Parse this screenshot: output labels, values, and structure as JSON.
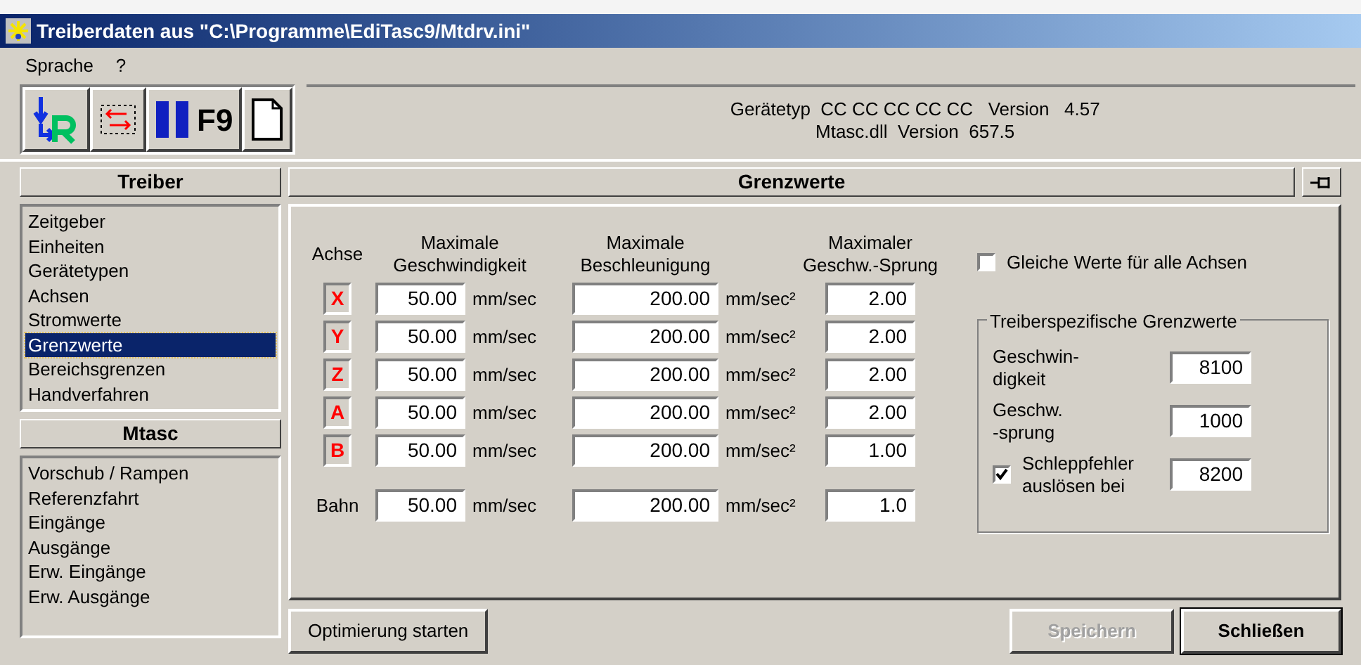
{
  "window": {
    "title": "Treiberdaten aus \"C:\\Programme\\EdiTasc9/Mtdrv.ini\""
  },
  "menu": [
    {
      "label": "Sprache"
    },
    {
      "label": "?"
    }
  ],
  "toolbar": [
    {
      "kind": "import"
    },
    {
      "kind": "swap"
    },
    {
      "kind": "pause",
      "label": "F9"
    },
    {
      "kind": "new"
    }
  ],
  "device_info": [
    "Gerätetyp  CC CC CC CC CC   Version   4.57",
    "Mtasc.dll  Version  657.5"
  ],
  "sidebar": [
    {
      "title": "Treiber",
      "items": [
        {
          "label": "Zeitgeber",
          "selected": false
        },
        {
          "label": "Einheiten",
          "selected": false
        },
        {
          "label": "Gerätetypen",
          "selected": false
        },
        {
          "label": "Achsen",
          "selected": false
        },
        {
          "label": "Stromwerte",
          "selected": false
        },
        {
          "label": "Grenzwerte",
          "selected": true
        },
        {
          "label": "Bereichsgrenzen",
          "selected": false
        },
        {
          "label": "Handverfahren",
          "selected": false
        }
      ]
    },
    {
      "title": "Mtasc",
      "items": [
        {
          "label": "Vorschub / Rampen",
          "selected": false
        },
        {
          "label": "Referenzfahrt",
          "selected": false
        },
        {
          "label": "Eingänge",
          "selected": false
        },
        {
          "label": "Ausgänge",
          "selected": false
        },
        {
          "label": "Erw. Eingänge",
          "selected": false
        },
        {
          "label": "Erw. Ausgänge",
          "selected": false
        }
      ]
    }
  ],
  "panel": {
    "title": "Grenzwerte"
  },
  "limits": {
    "axis_header": "Achse",
    "headers": [
      "Maximale\nGeschwindigkeit",
      "Maximale\nBeschleunigung",
      "Maximaler\nGeschw.-Sprung"
    ],
    "rows": [
      {
        "kind": "axis",
        "axis": "X",
        "speed": "50.00",
        "speed_unit": "mm/sec",
        "accel": "200.00",
        "accel_unit": "mm/sec²",
        "jump": "2.00"
      },
      {
        "kind": "axis",
        "axis": "Y",
        "speed": "50.00",
        "speed_unit": "mm/sec",
        "accel": "200.00",
        "accel_unit": "mm/sec²",
        "jump": "2.00"
      },
      {
        "kind": "axis",
        "axis": "Z",
        "speed": "50.00",
        "speed_unit": "mm/sec",
        "accel": "200.00",
        "accel_unit": "mm/sec²",
        "jump": "2.00"
      },
      {
        "kind": "axis",
        "axis": "A",
        "speed": "50.00",
        "speed_unit": "mm/sec",
        "accel": "200.00",
        "accel_unit": "mm/sec²",
        "jump": "2.00"
      },
      {
        "kind": "axis",
        "axis": "B",
        "speed": "50.00",
        "speed_unit": "mm/sec",
        "accel": "200.00",
        "accel_unit": "mm/sec²",
        "jump": "1.00"
      },
      {
        "kind": "path",
        "axis": "Bahn",
        "speed": "50.00",
        "speed_unit": "mm/sec",
        "accel": "200.00",
        "accel_unit": "mm/sec²",
        "jump": "1.0"
      }
    ]
  },
  "same_for_all": {
    "label": "Gleiche Werte für alle Achsen",
    "checked": false
  },
  "driver_limits": {
    "title": "Treiberspezifische Grenzwerte",
    "fields": [
      {
        "kind": "text",
        "label": "Geschwin-\ndigkeit",
        "value": "8100"
      },
      {
        "kind": "text",
        "label": "Geschw.\n-sprung",
        "value": "1000"
      },
      {
        "kind": "checkbox",
        "label": "Schleppfehler\nauslösen bei",
        "checked": true,
        "value": "8200"
      }
    ]
  },
  "buttons": [
    {
      "label": "Optimierung starten",
      "disabled": false,
      "default": false
    },
    {
      "label": "Speichern",
      "disabled": true,
      "default": false
    },
    {
      "label": "Schließen",
      "disabled": false,
      "default": true
    }
  ]
}
